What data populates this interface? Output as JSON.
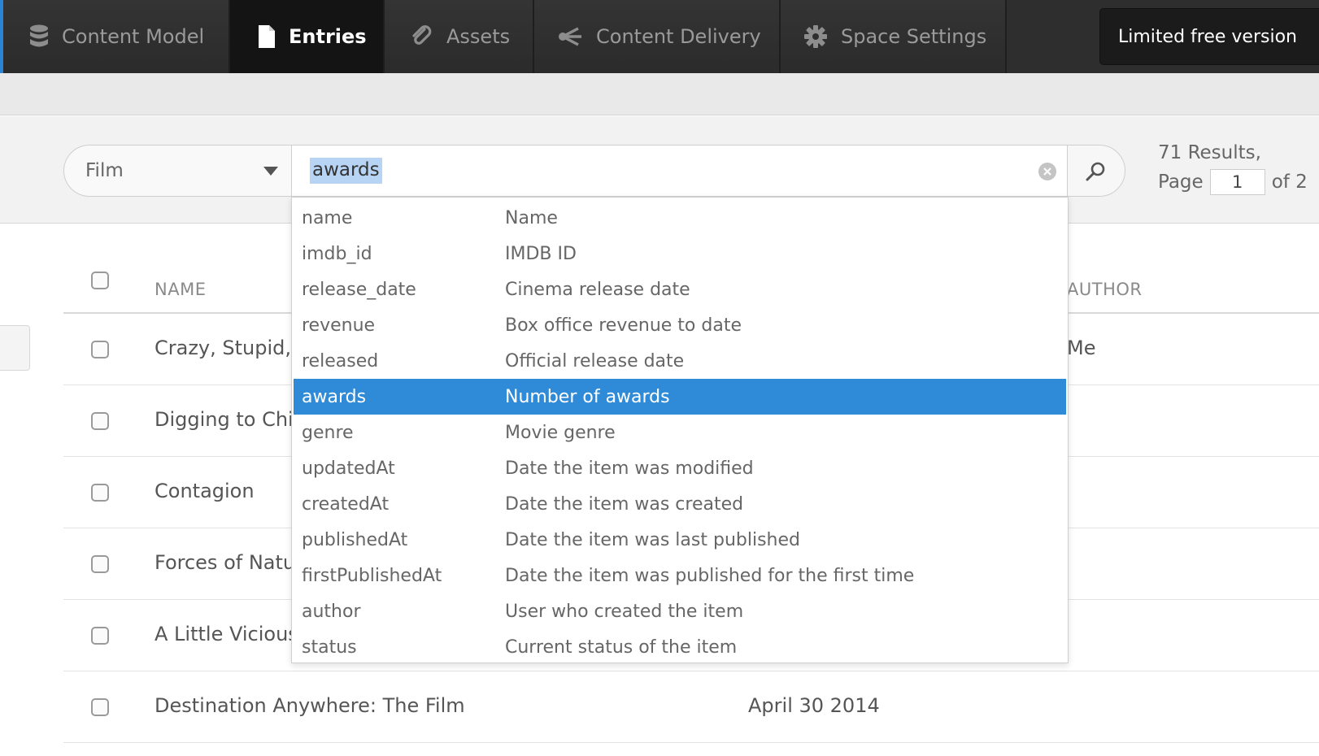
{
  "nav": {
    "tabs": [
      {
        "label": "Content Model",
        "icon": "database-icon"
      },
      {
        "label": "Entries",
        "icon": "document-icon",
        "active": true
      },
      {
        "label": "Assets",
        "icon": "paperclip-icon"
      },
      {
        "label": "Content Delivery",
        "icon": "share-icon"
      },
      {
        "label": "Space Settings",
        "icon": "gear-icon"
      }
    ],
    "limited_label": "Limited free version"
  },
  "search": {
    "content_type": "Film",
    "query": "awards"
  },
  "results": {
    "count_text": "71 Results,",
    "page_label": "Page",
    "page_value": "1",
    "of_text": "of 2"
  },
  "table": {
    "headers": {
      "name": "NAME",
      "author": "AUTHOR"
    },
    "rows": [
      {
        "name": "Crazy, Stupid, Love",
        "updated": "",
        "author": "Me"
      },
      {
        "name": "Digging to China",
        "updated": "",
        "author": ""
      },
      {
        "name": "Contagion",
        "updated": "",
        "author": ""
      },
      {
        "name": "Forces of Nature",
        "updated": "",
        "author": ""
      },
      {
        "name": "A Little Vicious",
        "updated": "",
        "author": ""
      },
      {
        "name": "Destination Anywhere: The Film",
        "updated": "April 30 2014",
        "author": ""
      }
    ]
  },
  "suggestions": [
    {
      "key": "name",
      "desc": "Name"
    },
    {
      "key": "imdb_id",
      "desc": "IMDB ID"
    },
    {
      "key": "release_date",
      "desc": "Cinema release date"
    },
    {
      "key": "revenue",
      "desc": "Box office revenue to date"
    },
    {
      "key": "released",
      "desc": "Official release date"
    },
    {
      "key": "awards",
      "desc": "Number of awards",
      "selected": true
    },
    {
      "key": "genre",
      "desc": "Movie genre"
    },
    {
      "key": "updatedAt",
      "desc": "Date the item was modified"
    },
    {
      "key": "createdAt",
      "desc": "Date the item was created"
    },
    {
      "key": "publishedAt",
      "desc": "Date the item was last published"
    },
    {
      "key": "firstPublishedAt",
      "desc": "Date the item was published for the first time"
    },
    {
      "key": "author",
      "desc": "User who created the item"
    },
    {
      "key": "status",
      "desc": "Current status of the item"
    }
  ],
  "colors": {
    "nav_bg": "#2e2e2e",
    "nav_active_bg": "#141414",
    "accent": "#2a84d6",
    "selected_bg": "#2f8bd8",
    "query_highlight": "#b7d4f5"
  }
}
